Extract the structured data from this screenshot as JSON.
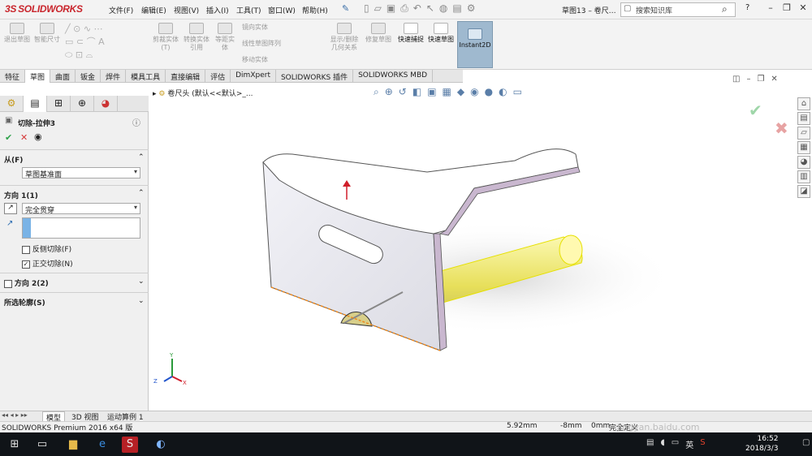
{
  "app": {
    "logo": "SOLIDWORKS",
    "logo_mark": "3S",
    "document_title": "草图13 – 卷尺…"
  },
  "menu": [
    "文件(F)",
    "编辑(E)",
    "视图(V)",
    "插入(I)",
    "工具(T)",
    "窗口(W)",
    "帮助(H)"
  ],
  "search": {
    "placeholder": "搜索知识库"
  },
  "ribbon": {
    "buttons": [
      "退出草图",
      "智能尺寸",
      "剪裁实体(T)",
      "转换实体引用",
      "等距实体",
      "显示/删除几何关系",
      "修复草图",
      "快速捕捉",
      "快速草图",
      "Instant2D"
    ],
    "small_items": [
      "镜向实体",
      "线性草图阵列",
      "移动实体"
    ]
  },
  "tabs": [
    "特征",
    "草图",
    "曲面",
    "钣金",
    "焊件",
    "模具工具",
    "直接编辑",
    "评估",
    "DimXpert",
    "SOLIDWORKS 插件",
    "SOLIDWORKS MBD"
  ],
  "tree_path": "卷尺头  (默认<<默认>_...",
  "property_manager": {
    "title": "切除-拉伸3",
    "from_label": "从(F)",
    "from_value": "草图基准面",
    "dir1_label": "方向 1(1)",
    "dir1_value": "完全贯穿",
    "flip_side_label": "反侧切除(F)",
    "normal_cut_label": "正交切除(N)",
    "dir2_label": "方向 2(2)",
    "contours_label": "所选轮廓(S)"
  },
  "bottom_tabs": [
    "模型",
    "3D 视图",
    "运动算例 1"
  ],
  "status": {
    "product": "SOLIDWORKS Premium 2016 x64 版",
    "x": "5.92mm",
    "y": "-8mm",
    "z": "0mm",
    "state": "完全定义",
    "watermark": "jingyan.baidu.com"
  },
  "taskbar": {
    "time": "16:52",
    "date": "2018/3/3",
    "ime": "英"
  },
  "triad": {
    "x": "X",
    "y": "Y",
    "z": "Z"
  },
  "colors": {
    "part_face": "#e8e8ef",
    "cut_preview": "#f5f07a",
    "confirm": "#2ea14a",
    "cancel": "#d63a3a",
    "ribbon_active": "#9fb9cf"
  }
}
